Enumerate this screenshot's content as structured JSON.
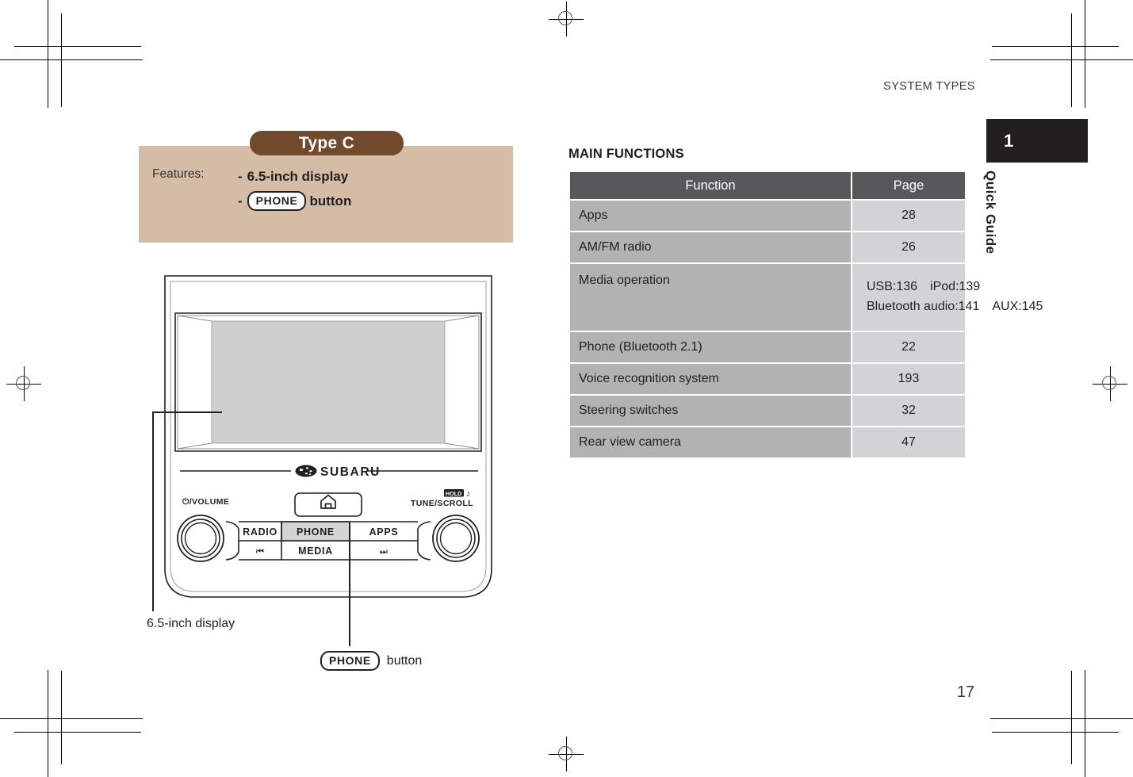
{
  "page": {
    "header_title": "SYSTEM TYPES",
    "page_number": "17",
    "chapter_number": "1",
    "chapter_label": "Quick Guide"
  },
  "type_panel": {
    "banner": "Type C",
    "features_label": "Features:",
    "feature_1_dash": "-",
    "feature_1": "6.5-inch display",
    "feature_2_dash": "-",
    "feature_2_key": "PHONE",
    "feature_2_suffix": "button"
  },
  "illustration": {
    "brand": "SUBARU",
    "knob_left_label": "/VOLUME",
    "knob_left_power_glyph": "⏻",
    "knob_right_label": "TUNE/SCROLL",
    "knob_right_hold": "HOLD",
    "knob_right_note": "♪",
    "home_icon": "home-icon",
    "buttons": {
      "radio": "RADIO",
      "phone": "PHONE",
      "apps": "APPS",
      "media": "MEDIA",
      "prev": "⏮",
      "next": "⏭"
    }
  },
  "callouts": {
    "display": "6.5-inch display",
    "phone_key": "PHONE",
    "phone_suffix": "button"
  },
  "main_functions": {
    "title": "MAIN FUNCTIONS",
    "columns": [
      "Function",
      "Page"
    ],
    "rows": [
      {
        "function": "Apps",
        "page": "28"
      },
      {
        "function": "AM/FM radio",
        "page": "26"
      },
      {
        "function": "Media operation",
        "page_multiline": true,
        "page_line_1": "USB:136 iPod:139",
        "page_line_2": "Bluetooth audio:141 AUX:145"
      },
      {
        "function": "Phone (Bluetooth 2.1)",
        "page": "22"
      },
      {
        "function": "Voice recognition system",
        "page": "193"
      },
      {
        "function": "Steering switches",
        "page": "32"
      },
      {
        "function": "Rear view camera",
        "page": "47"
      }
    ]
  },
  "colors": {
    "brown": "#71492C",
    "tan": "#D4BCA6",
    "table_header": "#58585A",
    "cell_function": "#B2B2B2",
    "cell_page": "#D2D3D5",
    "chapter_tab": "#231F20"
  }
}
